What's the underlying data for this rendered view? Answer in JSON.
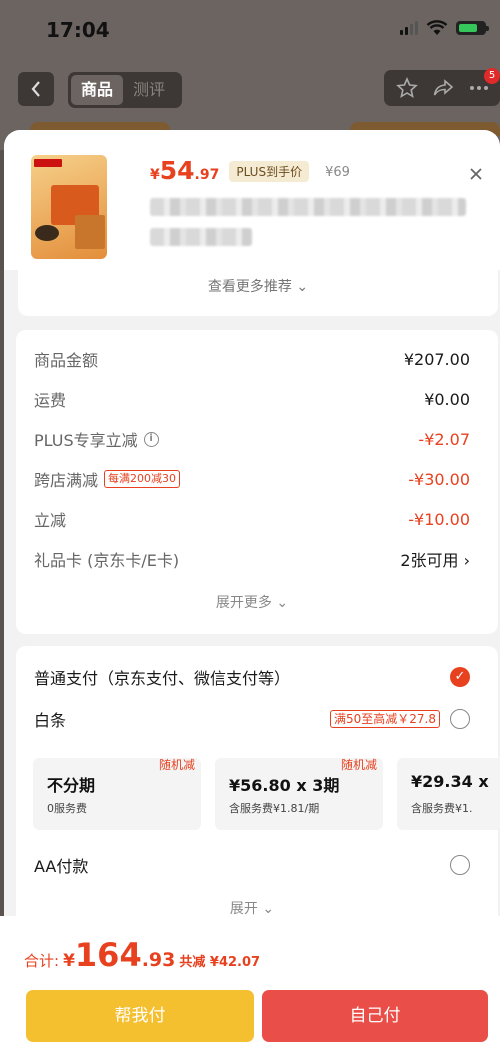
{
  "status_bar": {
    "time": "17:04"
  },
  "nav": {
    "tab_product": "商品",
    "tab_review": "测评",
    "cart_badge": "5"
  },
  "product": {
    "price_symbol": "¥",
    "price_int": "54",
    "price_dec": ".97",
    "plus_tag": "PLUS到手价",
    "original_price": "¥69",
    "more_recommend": "查看更多推荐 ⌄"
  },
  "summary": {
    "rows": [
      {
        "label": "商品金额",
        "value": "¥207.00"
      },
      {
        "label": "运费",
        "value": "¥0.00"
      },
      {
        "label": "PLUS专享立减",
        "value": "-¥2.07"
      },
      {
        "label": "跨店满减",
        "tag": "每满200减30",
        "value": "-¥30.00"
      },
      {
        "label": "立减",
        "value": "-¥10.00"
      },
      {
        "label": "礼品卡 (京东卡/E卡)",
        "value": "2张可用 ›"
      }
    ],
    "expand_more": "展开更多 ⌄"
  },
  "payment": {
    "normal_label": "普通支付（京东支付、微信支付等）",
    "baitiao_label": "白条",
    "baitiao_promo": "满50至高减￥27.8",
    "installments": [
      {
        "title": "不分期",
        "sub": "0服务费",
        "badge": "随机减"
      },
      {
        "title": "¥56.80 x 3期",
        "sub": "含服务费¥1.81/期",
        "badge": "随机减"
      },
      {
        "title": "¥29.34 x",
        "sub": "含服务费¥1.",
        "badge": ""
      }
    ],
    "aa_label": "AA付款",
    "expand": "展开 ⌄"
  },
  "footer": {
    "total_label": "合计:",
    "total_symbol": "¥",
    "total_int": "164",
    "total_dec": ".93",
    "discount": "共减 ¥42.07",
    "help_pay": "帮我付",
    "self_pay": "自己付"
  },
  "colors": {
    "accent_red": "#e8411f",
    "help_btn": "#f4c030",
    "self_btn": "#e94e48"
  }
}
